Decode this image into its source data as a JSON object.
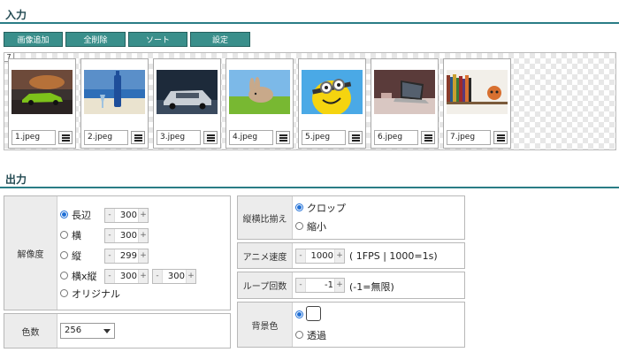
{
  "input_section": {
    "title": "入力"
  },
  "toolbar": {
    "add_image": "画像追加",
    "delete_all": "全削除",
    "sort": "ソート",
    "settings": "設定"
  },
  "image_strip": {
    "count": "7",
    "images": [
      {
        "name": "1.jpeg",
        "subject": "green sports car at sunset",
        "colors": [
          "#3a3230",
          "#c87a3a",
          "#7dc21a"
        ]
      },
      {
        "name": "2.jpeg",
        "subject": "blue wine bottle on beach",
        "colors": [
          "#2f6fb8",
          "#eae3cf",
          "#1e4e9a"
        ]
      },
      {
        "name": "3.jpeg",
        "subject": "silver car front",
        "colors": [
          "#1d2a3a",
          "#c9cfd6",
          "#3a4a5e"
        ]
      },
      {
        "name": "4.jpeg",
        "subject": "rabbit on grass",
        "colors": [
          "#7cb9e8",
          "#78b832",
          "#c8a98a"
        ]
      },
      {
        "name": "5.jpeg",
        "subject": "minion cartoon",
        "colors": [
          "#4aa9e6",
          "#f5d40f",
          "#6e6e6e"
        ]
      },
      {
        "name": "6.jpeg",
        "subject": "laptop on dark table",
        "colors": [
          "#5a3b3a",
          "#d9c7c2",
          "#2a2a2a"
        ]
      },
      {
        "name": "7.jpeg",
        "subject": "bookshelf with toy",
        "colors": [
          "#f2efe9",
          "#8a3b2a",
          "#d87030"
        ]
      }
    ]
  },
  "output_section": {
    "title": "出力"
  },
  "resolution": {
    "label": "解像度",
    "options": [
      {
        "label": "長辺",
        "selected": true,
        "value": "300"
      },
      {
        "label": "横",
        "selected": false,
        "value": "300"
      },
      {
        "label": "縦",
        "selected": false,
        "value": "299"
      },
      {
        "label": "横x縦",
        "selected": false,
        "value": "300",
        "value2": "300"
      },
      {
        "label": "オリジナル",
        "selected": false
      }
    ]
  },
  "colors": {
    "label": "色数",
    "value": "256"
  },
  "aspect": {
    "label": "縦横比揃え",
    "options": [
      {
        "label": "クロップ",
        "selected": true
      },
      {
        "label": "縮小",
        "selected": false
      }
    ]
  },
  "anime_speed": {
    "label": "アニメ速度",
    "value": "1000",
    "note": "( 1FPS | 1000=1s)"
  },
  "loop_count": {
    "label": "ループ回数",
    "value": "-1",
    "note": "(-1=無限)"
  },
  "background": {
    "label": "背景色",
    "options": [
      {
        "label": "",
        "selected": true
      },
      {
        "label": "透過",
        "selected": false
      }
    ],
    "swatch_color": "#ffffff"
  },
  "spinner": {
    "minus": "-",
    "plus": "+"
  },
  "theme": {
    "accent": "#2a7d86",
    "button": "#3a8f8b",
    "radio": "#1f6fd6"
  }
}
